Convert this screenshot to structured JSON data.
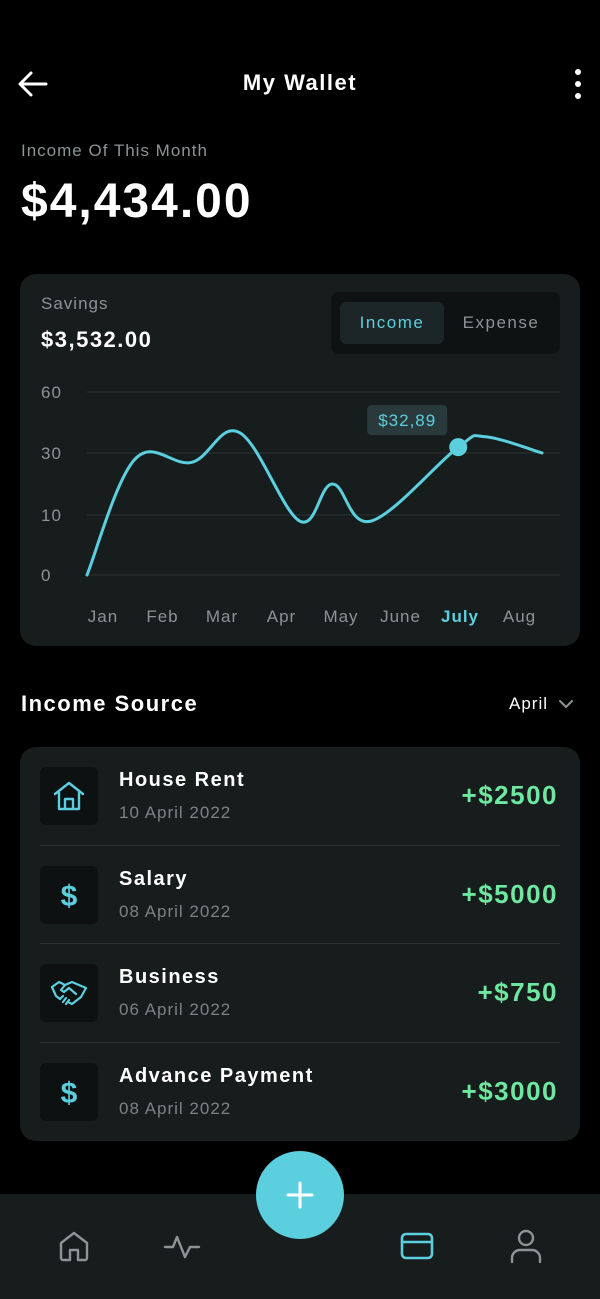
{
  "header": {
    "title": "My Wallet",
    "back_icon": "arrow-left-icon",
    "more_icon": "more-vertical-icon"
  },
  "summary": {
    "label": "Income Of This Month",
    "amount": "$4,434.00"
  },
  "savings_card": {
    "label": "Savings",
    "amount": "$3,532.00",
    "toggle": {
      "active": "Income",
      "inactive": "Expense"
    }
  },
  "chart_data": {
    "type": "line",
    "categories": [
      "Jan",
      "Feb",
      "Mar",
      "Apr",
      "May",
      "June",
      "July",
      "Aug"
    ],
    "values": [
      0,
      28,
      27,
      40,
      9,
      20,
      9,
      32.89,
      38,
      30
    ],
    "x": [
      0,
      0.8,
      1.75,
      2.55,
      3.55,
      4.1,
      4.75,
      6.2,
      6.65,
      7.6
    ],
    "yticks": [
      0,
      10,
      30,
      60
    ],
    "highlight": {
      "category": "July",
      "label": "$32,89",
      "value": 32.89
    },
    "colors": {
      "line": "#5ccfdf",
      "grid": "#2d3436",
      "tick": "#8d9396",
      "highlight_tick": "#5ccfdf",
      "tooltip_bg": "#2a3a3c"
    }
  },
  "income_source": {
    "title": "Income Source",
    "month": "April",
    "items": [
      {
        "icon": "house-icon",
        "title": "House Rent",
        "date": "10 April 2022",
        "amount": "+$2500"
      },
      {
        "icon": "dollar-icon",
        "title": "Salary",
        "date": "08 April 2022",
        "amount": "+$5000"
      },
      {
        "icon": "handshake-icon",
        "title": "Business",
        "date": "06 April 2022",
        "amount": "+$750"
      },
      {
        "icon": "dollar-icon",
        "title": "Advance Payment",
        "date": "08 April 2022",
        "amount": "+$3000"
      }
    ]
  },
  "nav": {
    "items": [
      {
        "icon": "home-icon",
        "active": false
      },
      {
        "icon": "activity-icon",
        "active": false
      },
      {
        "icon": "wallet-card-icon",
        "active": true
      },
      {
        "icon": "user-icon",
        "active": false
      }
    ],
    "fab_icon": "plus-icon"
  },
  "colors": {
    "accent": "#5ccfdf",
    "positive": "#6ee7a0",
    "card": "#171c1d",
    "muted": "#8d9396"
  }
}
